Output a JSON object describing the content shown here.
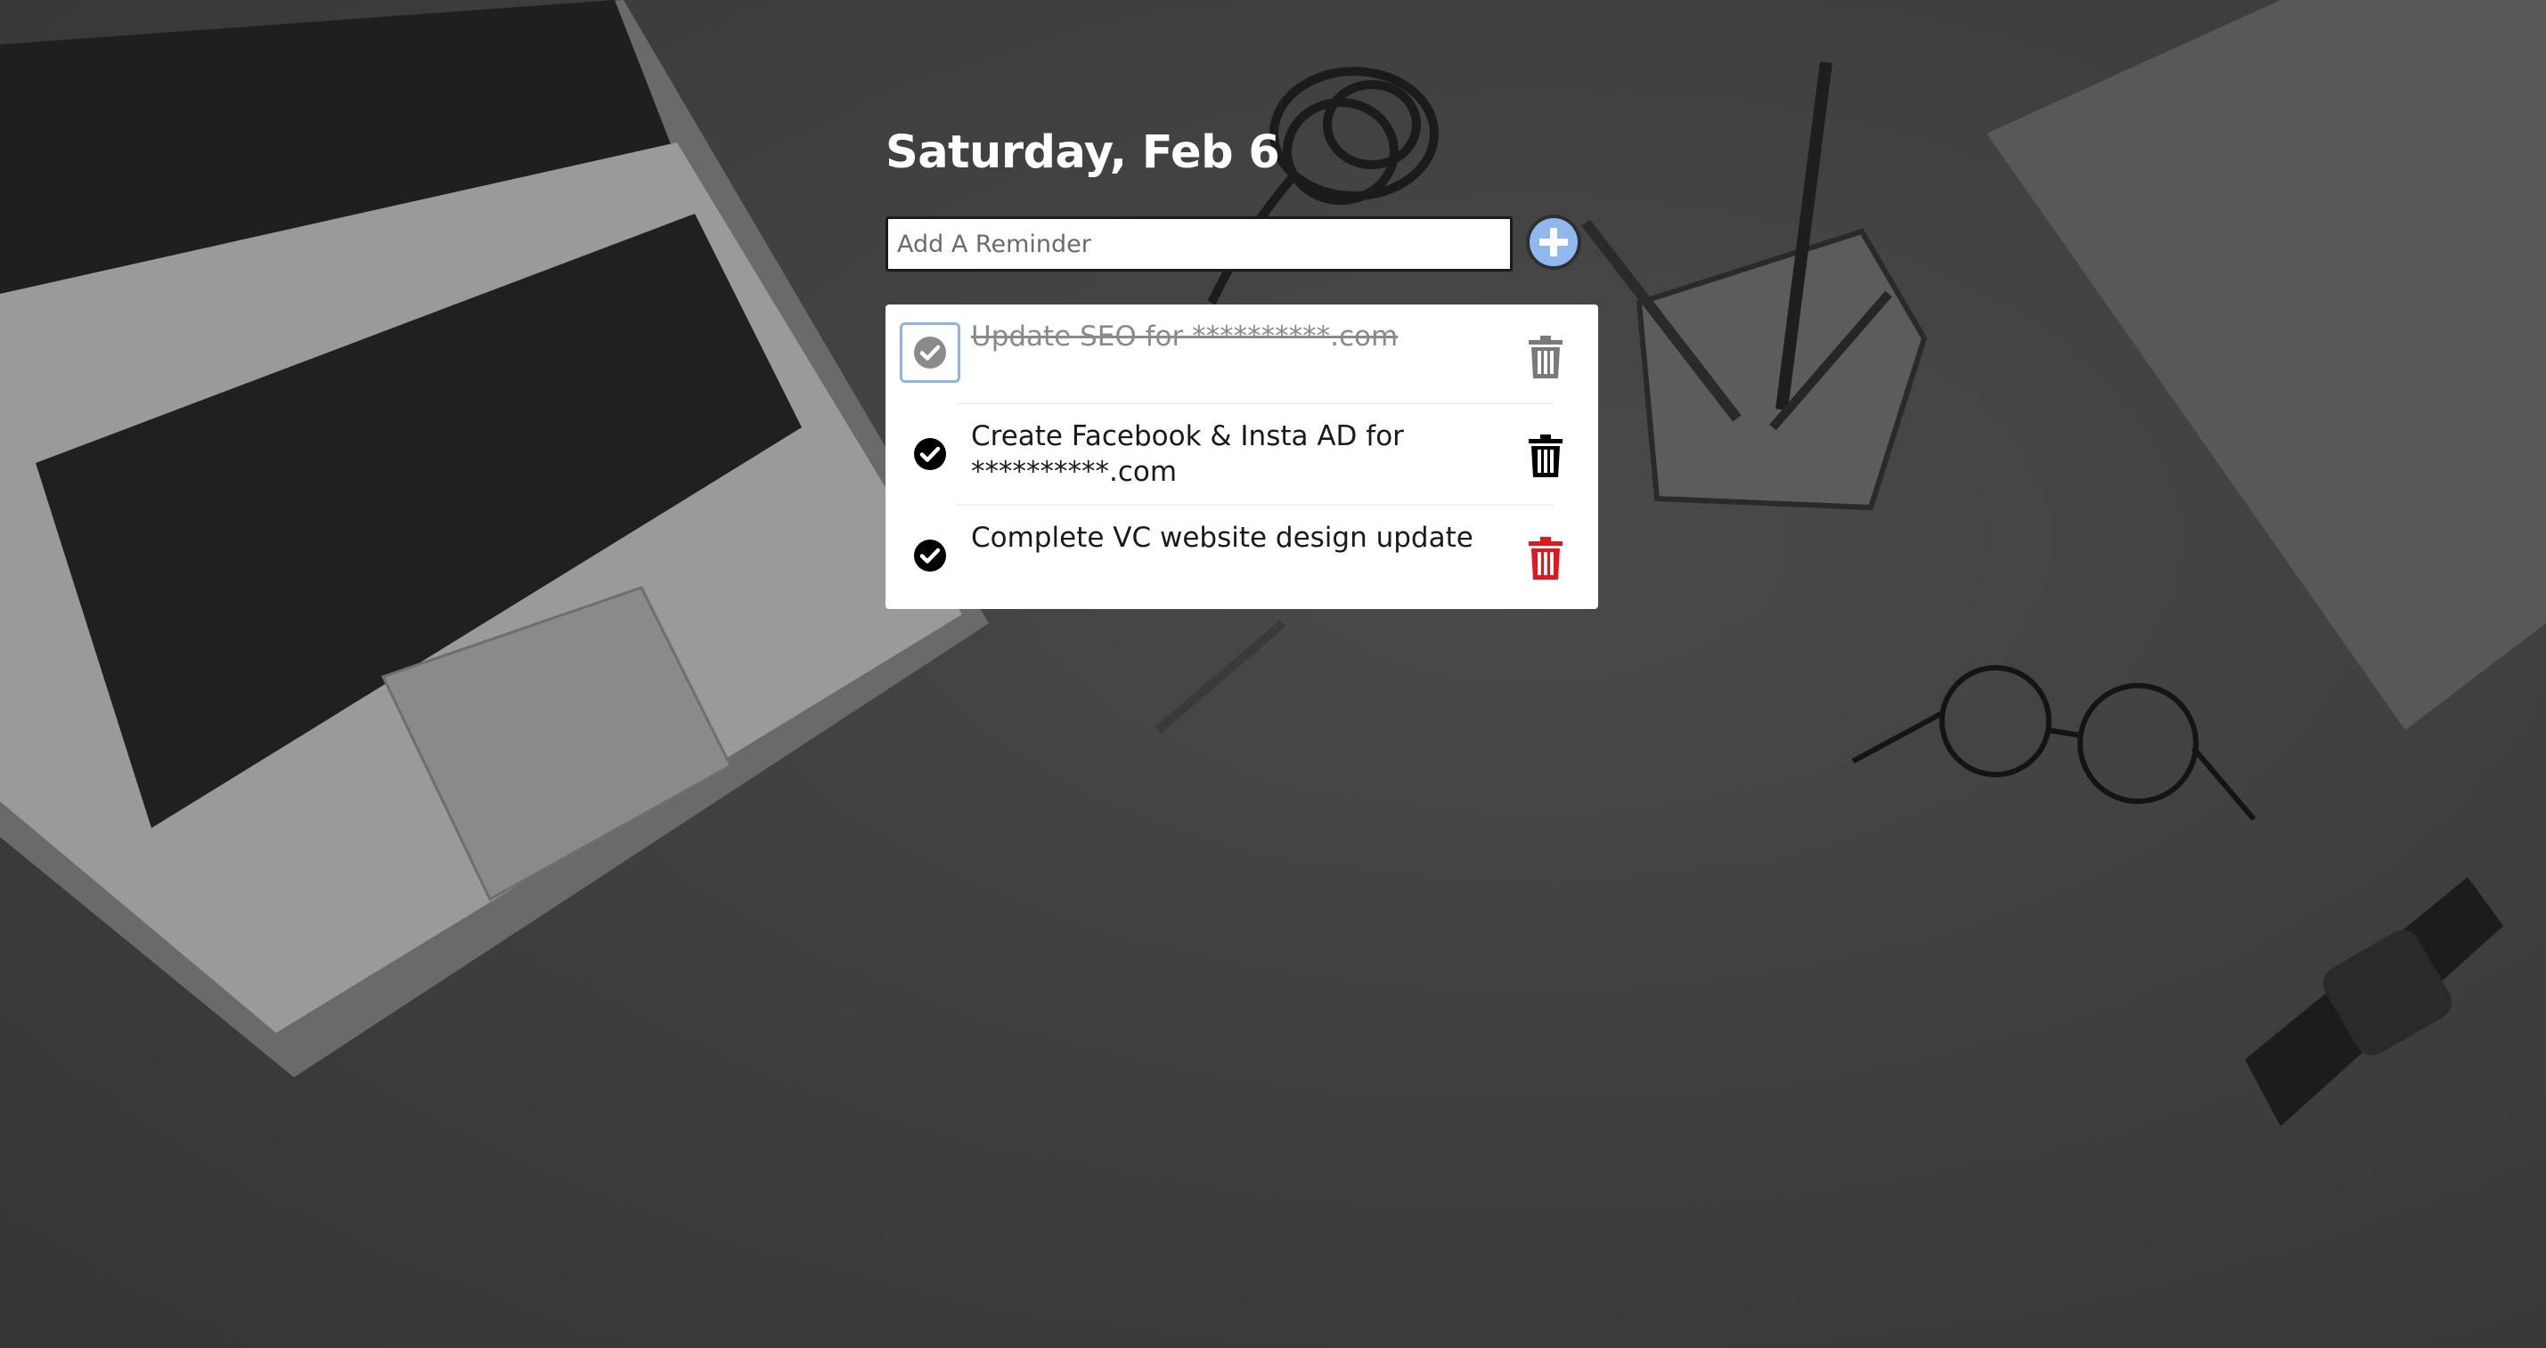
{
  "header": {
    "date_label": "Saturday, Feb 6"
  },
  "add_reminder": {
    "placeholder": "Add A Reminder",
    "value": "",
    "button_icon": "plus-icon"
  },
  "reminders": [
    {
      "text": "Update SEO for **********.com",
      "completed": true
    },
    {
      "text": "Create Facebook & Insta AD for **********.com",
      "completed": false
    },
    {
      "text": "Complete VC website design update",
      "completed": false
    }
  ],
  "icons": {
    "check": "check-circle-icon",
    "delete": "trash-icon"
  },
  "colors": {
    "accent": "#8fb8ef",
    "focus_outline": "#8fb2e8",
    "delete_hover": "#e8141c",
    "completed_text": "#8a8a8a"
  }
}
